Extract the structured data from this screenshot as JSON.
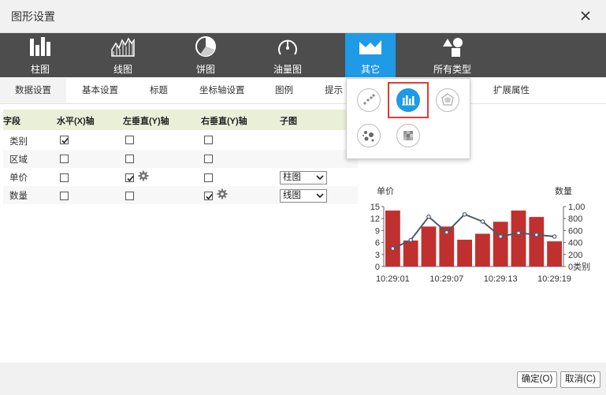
{
  "window": {
    "title": "图形设置"
  },
  "toolbar": {
    "items": [
      {
        "label": "柱图",
        "icon": "bar-chart-icon"
      },
      {
        "label": "线图",
        "icon": "line-chart-icon"
      },
      {
        "label": "饼图",
        "icon": "pie-chart-icon"
      },
      {
        "label": "油量图",
        "icon": "gauge-chart-icon"
      },
      {
        "label": "其它",
        "icon": "other-chart-icon",
        "active": true
      },
      {
        "label": "所有类型",
        "icon": "all-types-icon"
      }
    ]
  },
  "tabs": [
    {
      "label": "数据设置",
      "active": true
    },
    {
      "label": "基本设置"
    },
    {
      "label": "标题"
    },
    {
      "label": "坐标轴设置"
    },
    {
      "label": "图例"
    },
    {
      "label": "提示"
    },
    {
      "label": "扩展属性"
    }
  ],
  "grid": {
    "headers": [
      "字段",
      "水平(X)轴",
      "左垂直(Y)轴",
      "右垂直(Y)轴",
      "子图"
    ],
    "rows": [
      {
        "field": "类别",
        "x": true,
        "y_left": false,
        "y_right": false,
        "sub": ""
      },
      {
        "field": "区域",
        "x": false,
        "y_left": false,
        "y_right": false,
        "sub": ""
      },
      {
        "field": "单价",
        "x": false,
        "y_left": true,
        "y_right": false,
        "sub": "柱图"
      },
      {
        "field": "数量",
        "x": false,
        "y_left": false,
        "y_right": true,
        "sub": "线图"
      }
    ]
  },
  "popup": {
    "icons": [
      "scatter-chart-icon",
      "combo-chart-icon",
      "radar-chart-icon",
      "bubble-chart-icon",
      "heatmap-chart-icon"
    ],
    "selected": "combo-chart-icon"
  },
  "chart_data": {
    "type": "bar",
    "categories": [
      "10:29:01",
      "",
      "",
      "10:29:07",
      "",
      "",
      "10:29:13",
      "",
      "",
      "10:29:19"
    ],
    "tick_labels": [
      "10:29:01",
      "10:29:07",
      "10:29:13",
      "10:29:19"
    ],
    "series": [
      {
        "type": "bar",
        "axis": "left",
        "values": [
          14,
          6.5,
          10,
          10,
          6.7,
          8.2,
          11.2,
          14,
          12.4,
          6.3
        ]
      },
      {
        "type": "line",
        "axis": "right",
        "values": [
          300,
          440,
          830,
          570,
          870,
          750,
          500,
          560,
          530,
          500
        ]
      }
    ],
    "ylabel": "单价",
    "y2label": "数量",
    "ylim": [
      0,
      15
    ],
    "y2lim": [
      0,
      1000
    ],
    "yticks": [
      "15",
      "12",
      "9",
      "6",
      "3",
      "0"
    ],
    "y2ticks": [
      "1,00",
      "800",
      "600",
      "400",
      "200",
      "0类别"
    ],
    "bar_color": "#c0302e",
    "line_color": "#4a5a6e"
  },
  "footer": {
    "ok_label": "确定(O)",
    "cancel_label": "取消(C)"
  }
}
